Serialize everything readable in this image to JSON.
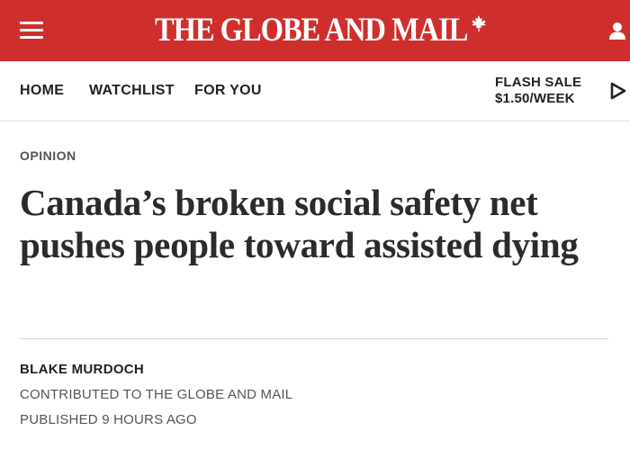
{
  "header": {
    "logo_text": "THE GLOBE AND MAIL",
    "logo_icon": "maple-leaf-icon",
    "menu_icon": "hamburger-menu-icon",
    "account_icon": "user-account-icon",
    "brand_color": "#cf2f2c"
  },
  "nav": {
    "links": [
      "HOME",
      "WATCHLIST",
      "FOR YOU"
    ],
    "promo_line1": "FLASH SALE",
    "promo_line2": "$1.50/WEEK",
    "promo_icon": "play-arrow-icon"
  },
  "article": {
    "section": "OPINION",
    "headline": "Canada’s broken social safety net pushes people toward assisted dying",
    "author": "BLAKE MURDOCH",
    "contribution": "CONTRIBUTED TO THE GLOBE AND MAIL",
    "published": "PUBLISHED 9 HOURS AGO"
  }
}
